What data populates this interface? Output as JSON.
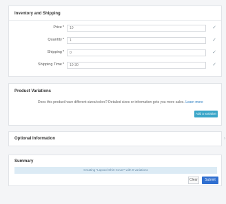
{
  "inventory": {
    "title": "Inventory and Shipping",
    "fields": [
      {
        "label": "Price",
        "required": "*",
        "value": "10"
      },
      {
        "label": "Quantity",
        "required": "*",
        "value": "1"
      },
      {
        "label": "Shipping",
        "required": "*",
        "value": "0"
      },
      {
        "label": "Shipping Time",
        "required": "*",
        "value": "10-30"
      }
    ],
    "check_icon": "check-icon"
  },
  "variations": {
    "title": "Product Variations",
    "description": "Does this product have different sizes/colors? Detailed sizes or information gets you more sales.",
    "learn_more": "Learn more",
    "add_button": "Add a variation"
  },
  "optional": {
    "title": "Optional Information"
  },
  "summary": {
    "title": "Summary",
    "info": "Creating \"Lapsed Shirt Cover\" with 0 variations",
    "clear_button": "Clear",
    "submit_button": "Submit"
  },
  "colors": {
    "page_bg": "#f4f5f7",
    "primary": "#2f6fd0",
    "accent": "#39a5c8",
    "info_bg": "#dcebf5"
  }
}
